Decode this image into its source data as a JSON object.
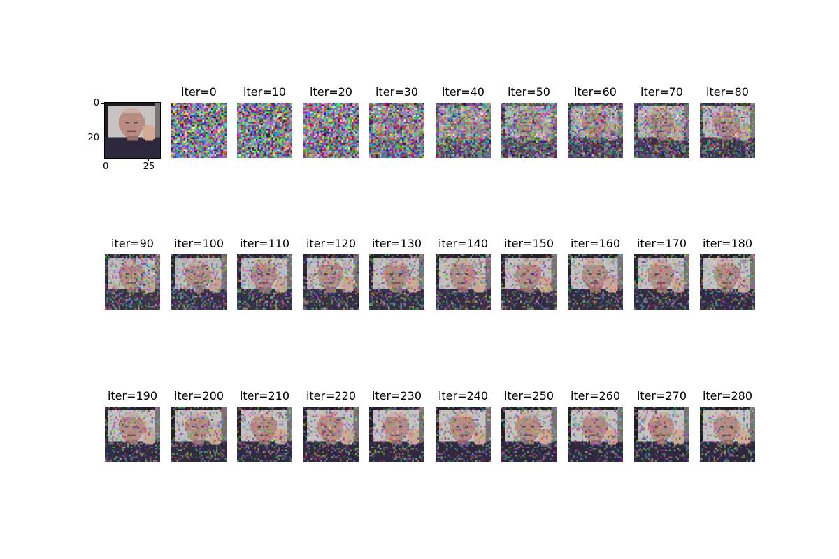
{
  "first_panel": {
    "description_free": true,
    "y_ticks": [
      "0",
      "20"
    ],
    "x_ticks": [
      "0",
      "25"
    ]
  },
  "panels": [
    {
      "title": "iter=0",
      "level": 0.0
    },
    {
      "title": "iter=10",
      "level": 0.02
    },
    {
      "title": "iter=20",
      "level": 0.08
    },
    {
      "title": "iter=30",
      "level": 0.22
    },
    {
      "title": "iter=40",
      "level": 0.35
    },
    {
      "title": "iter=50",
      "level": 0.45
    },
    {
      "title": "iter=60",
      "level": 0.52
    },
    {
      "title": "iter=70",
      "level": 0.58
    },
    {
      "title": "iter=80",
      "level": 0.62
    },
    {
      "title": "iter=90",
      "level": 0.66
    },
    {
      "title": "iter=100",
      "level": 0.68
    },
    {
      "title": "iter=110",
      "level": 0.7
    },
    {
      "title": "iter=120",
      "level": 0.71
    },
    {
      "title": "iter=130",
      "level": 0.72
    },
    {
      "title": "iter=140",
      "level": 0.73
    },
    {
      "title": "iter=150",
      "level": 0.74
    },
    {
      "title": "iter=160",
      "level": 0.745
    },
    {
      "title": "iter=170",
      "level": 0.75
    },
    {
      "title": "iter=180",
      "level": 0.755
    },
    {
      "title": "iter=190",
      "level": 0.76
    },
    {
      "title": "iter=200",
      "level": 0.765
    },
    {
      "title": "iter=210",
      "level": 0.77
    },
    {
      "title": "iter=220",
      "level": 0.775
    },
    {
      "title": "iter=230",
      "level": 0.78
    },
    {
      "title": "iter=240",
      "level": 0.785
    },
    {
      "title": "iter=250",
      "level": 0.79
    },
    {
      "title": "iter=260",
      "level": 0.79
    },
    {
      "title": "iter=270",
      "level": 0.795
    },
    {
      "title": "iter=280",
      "level": 0.8
    }
  ]
}
